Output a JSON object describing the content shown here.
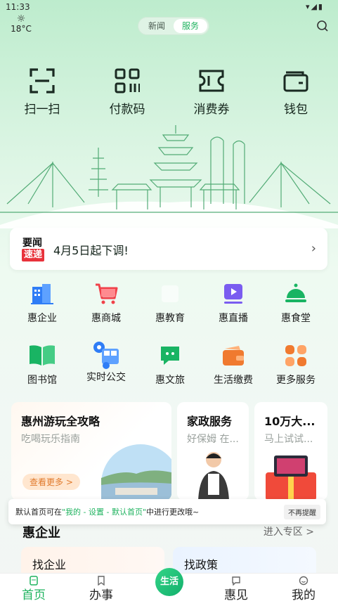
{
  "status_bar": {
    "time": "11:33",
    "weather_temp": "18°C"
  },
  "header": {
    "tabs": [
      "新闻",
      "服务"
    ],
    "active_tab": "服务"
  },
  "top_actions": [
    {
      "label": "扫一扫",
      "icon": "scan-icon"
    },
    {
      "label": "付款码",
      "icon": "qr-pay-icon"
    },
    {
      "label": "消费券",
      "icon": "coupon-icon"
    },
    {
      "label": "钱包",
      "icon": "wallet-icon"
    }
  ],
  "news": {
    "tag_line1": "要闻",
    "tag_line2": "速递",
    "headline": "4月5日起下调!"
  },
  "services": [
    {
      "label": "惠企业",
      "icon": "building-icon",
      "color": "#2f7df6"
    },
    {
      "label": "惠商城",
      "icon": "cart-icon",
      "color": "#f0424a"
    },
    {
      "label": "惠教育",
      "icon": "education-icon",
      "color": "#2f7df6"
    },
    {
      "label": "惠直播",
      "icon": "play-icon",
      "color": "#7a5cf0"
    },
    {
      "label": "惠食堂",
      "icon": "dish-icon",
      "color": "#19b463"
    },
    {
      "label": "图书馆",
      "icon": "book-icon",
      "color": "#19b463"
    },
    {
      "label": "实时公交",
      "icon": "bus-icon",
      "color": "#2f7df6"
    },
    {
      "label": "惠文旅",
      "icon": "chat-icon",
      "color": "#19b463"
    },
    {
      "label": "生活缴费",
      "icon": "wallet-fee-icon",
      "color": "#f07a2f"
    },
    {
      "label": "更多服务",
      "icon": "grid-more-icon",
      "color": "#f07a2f"
    }
  ],
  "cards": [
    {
      "title": "惠州游玩全攻略",
      "subtitle": "吃喝玩乐指南",
      "button": "查看更多 >"
    },
    {
      "title": "家政服务",
      "subtitle": "好保姆 在..."
    },
    {
      "title": "10万大...",
      "subtitle": "马上试试..."
    }
  ],
  "toast": {
    "before": "默认首页可在",
    "highlight": "\"我的 - 设置 - 默认首页\"",
    "after": "中进行更改哦~",
    "dismiss": "不再提醒"
  },
  "section": {
    "title": "惠企业",
    "more": "进入专区 >"
  },
  "sub_cards": [
    "找企业",
    "找政策"
  ],
  "bottom_nav": [
    {
      "label": "首页",
      "icon": "home-icon",
      "active": true
    },
    {
      "label": "办事",
      "icon": "bookmark-icon",
      "active": false
    },
    {
      "label": "生活",
      "icon": "life-icon",
      "active": false
    },
    {
      "label": "惠见",
      "icon": "message-icon",
      "active": false
    },
    {
      "label": "我的",
      "icon": "profile-icon",
      "active": false
    }
  ]
}
